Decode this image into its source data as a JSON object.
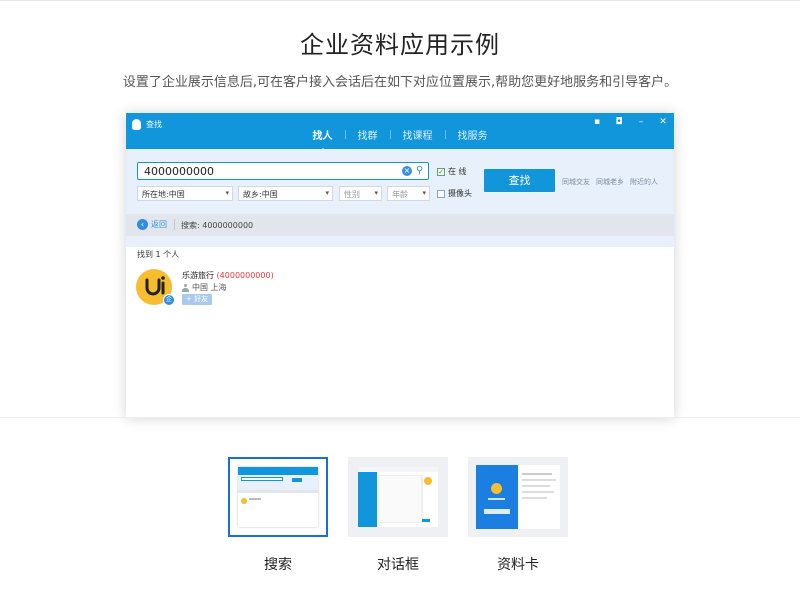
{
  "header": {
    "title": "企业资料应用示例",
    "subtitle": "设置了企业展示信息后,可在客户接入会话后在如下对应位置展示,帮助您更好地服务和引导客户。"
  },
  "window": {
    "title": "查找",
    "tabs": [
      {
        "label": "找人",
        "active": true
      },
      {
        "label": "找群",
        "active": false
      },
      {
        "label": "找课程",
        "active": false
      },
      {
        "label": "找服务",
        "active": false
      }
    ],
    "search": {
      "value": "4000000000",
      "online_label": "在 线",
      "online_checked": true,
      "camera_label": "摄像头",
      "camera_checked": false,
      "find_button": "查找",
      "filters": {
        "location": "所在地:中国",
        "hometown": "故乡:中国",
        "gender": "性别",
        "age": "年龄"
      },
      "quick_links": [
        "同城交友",
        "同城老乡",
        "附近的人"
      ]
    },
    "breadcrumb": {
      "back_label": "返回",
      "query_text": "搜索: 4000000000"
    },
    "results": {
      "count_text": "找到 1 个人",
      "items": [
        {
          "name": "乐游旅行",
          "id_text": "(4000000000)",
          "location": "中国 上海",
          "add_label": "+ 好友"
        }
      ]
    }
  },
  "thumbnails": [
    {
      "label": "搜索",
      "active": true
    },
    {
      "label": "对话框",
      "active": false
    },
    {
      "label": "资料卡",
      "active": false
    }
  ],
  "colors": {
    "qq_blue": "#1296db",
    "accent_red": "#e23a3a",
    "avatar_yellow": "#f6be2e",
    "active_border": "#1a6ed8"
  }
}
